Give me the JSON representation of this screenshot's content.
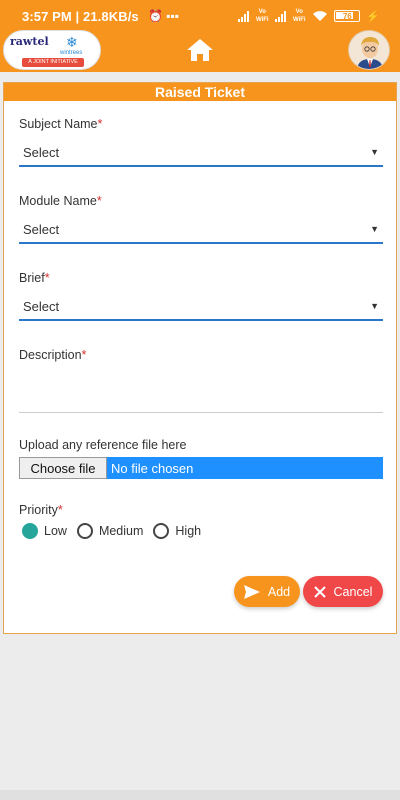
{
  "status_bar": {
    "time": "3:57 PM",
    "speed": "21.8KB/s",
    "battery": "76",
    "network_labels": [
      "Vo WiFi",
      "Vo WiFi"
    ]
  },
  "header": {
    "logo_text": "rawtel",
    "logo_partner": "wintrees",
    "logo_tagline": "A JOINT INITIATIVE",
    "home_icon": "home-icon",
    "avatar_icon": "user-avatar"
  },
  "form": {
    "title": "Raised Ticket",
    "required_mark": "*",
    "subject_label": "Subject Name",
    "subject_value": "Select",
    "module_label": "Module Name",
    "module_value": "Select",
    "brief_label": "Brief",
    "brief_value": "Select",
    "description_label": "Description",
    "upload_label": "Upload any reference file here",
    "choose_file_label": "Choose file",
    "no_file_text": "No file chosen",
    "priority_label": "Priority",
    "priority_options": [
      "Low",
      "Medium",
      "High"
    ],
    "priority_selected": "Low",
    "add_label": "Add",
    "cancel_label": "Cancel"
  },
  "colors": {
    "primary": "#f7941d",
    "accent": "#2a76c9",
    "danger": "#f04848",
    "radio_on": "#26a69a",
    "file_bar": "#1e90ff"
  }
}
